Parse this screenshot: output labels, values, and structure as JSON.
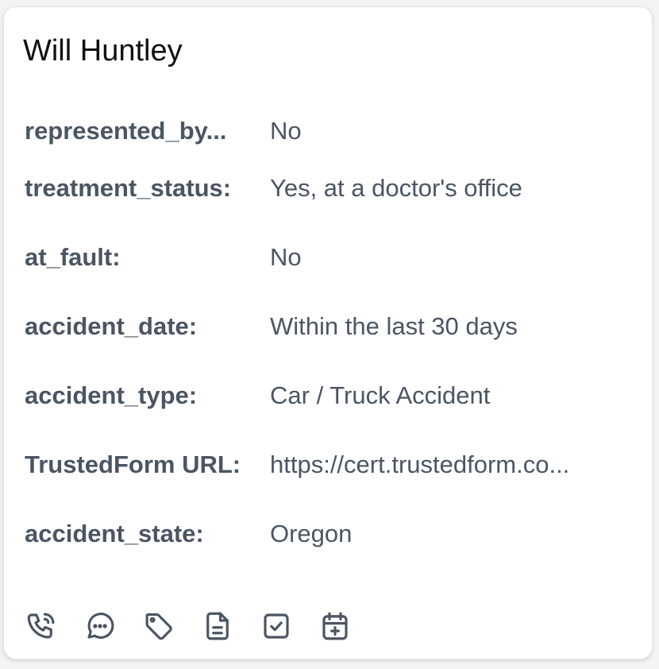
{
  "contact": {
    "name": "Will Huntley"
  },
  "fields": [
    {
      "label": "represented_by...",
      "value": "No"
    },
    {
      "label": "treatment_status:",
      "value": "Yes, at a doctor's office"
    },
    {
      "label": "at_fault:",
      "value": "No"
    },
    {
      "label": "accident_date:",
      "value": "Within the last 30 days"
    },
    {
      "label": "accident_type:",
      "value": "Car / Truck Accident"
    },
    {
      "label": "TrustedForm URL:",
      "value": "https://cert.trustedform.co..."
    },
    {
      "label": "accident_state:",
      "value": "Oregon"
    }
  ],
  "actions": [
    {
      "icon": "phone-call-icon"
    },
    {
      "icon": "chat-bubble-icon"
    },
    {
      "icon": "tag-icon"
    },
    {
      "icon": "document-icon"
    },
    {
      "icon": "checkbox-icon"
    },
    {
      "icon": "calendar-add-icon"
    }
  ],
  "colors": {
    "text_primary": "#111111",
    "text_secondary": "#4b5563",
    "card_border": "#e3e5e8"
  }
}
